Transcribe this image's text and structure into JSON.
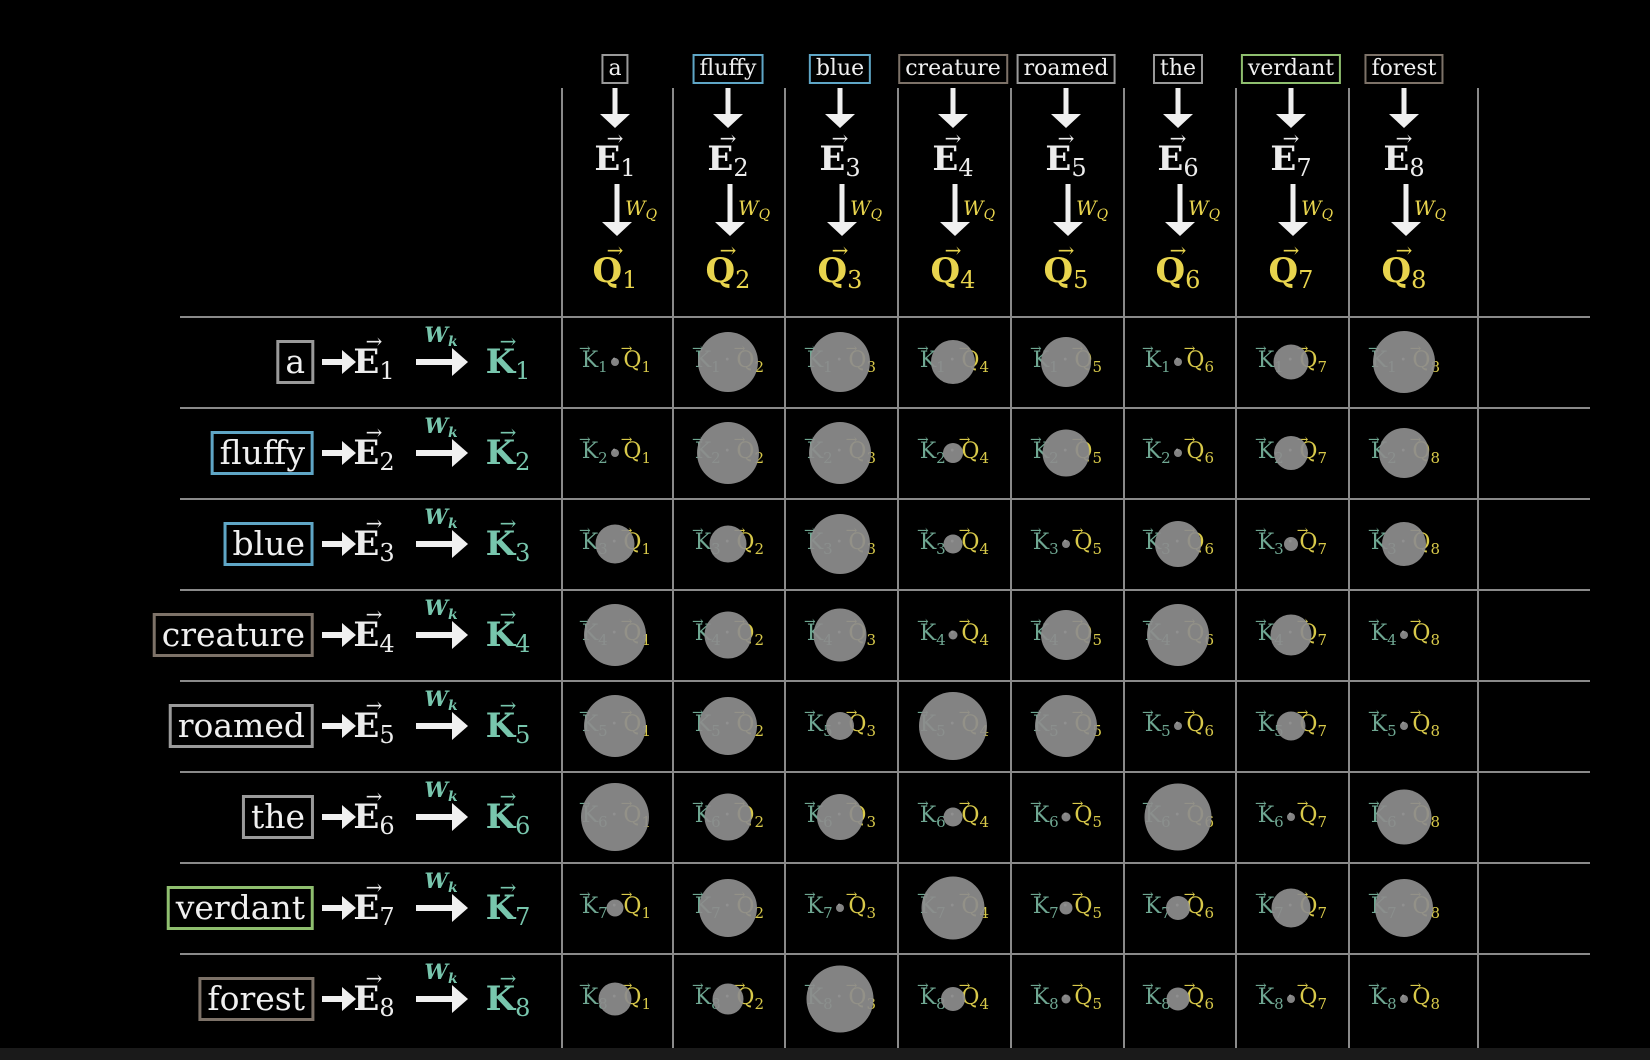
{
  "tokens": [
    "a",
    "fluffy",
    "blue",
    "creature",
    "roamed",
    "the",
    "verdant",
    "forest"
  ],
  "token_colors": [
    "#9a9a9a",
    "#5fa6c6",
    "#5fa6c6",
    "#7d7268",
    "#9a9a9a",
    "#9a9a9a",
    "#8fbf6f",
    "#7d7268"
  ],
  "symbols": {
    "embedding": "E",
    "query": "Q",
    "key": "K",
    "query_matrix": "W",
    "query_matrix_sub": "Q",
    "key_matrix": "W",
    "key_matrix_sub": "k",
    "vector_arrow": "⃗",
    "dot_operator": "·"
  },
  "colors": {
    "query": "#e8d44d",
    "key": "#78c6ad",
    "grid": "#8a8a8a",
    "circle": "#8d8d8d"
  },
  "dot_product_magnitudes": [
    [
      0.12,
      0.88,
      0.88,
      0.64,
      0.74,
      0.06,
      0.51,
      0.91
    ],
    [
      0.05,
      0.91,
      0.91,
      0.3,
      0.69,
      0.05,
      0.5,
      0.74
    ],
    [
      0.57,
      0.55,
      0.88,
      0.28,
      0.09,
      0.67,
      0.2,
      0.65
    ],
    [
      0.91,
      0.69,
      0.78,
      0.13,
      0.74,
      0.91,
      0.6,
      0.06
    ],
    [
      0.91,
      0.86,
      0.41,
      1.0,
      0.91,
      0.06,
      0.43,
      0.06
    ],
    [
      1.0,
      0.69,
      0.67,
      0.28,
      0.13,
      0.99,
      0.06,
      0.81
    ],
    [
      0.25,
      0.86,
      0.09,
      0.93,
      0.19,
      0.35,
      0.58,
      0.86
    ],
    [
      0.48,
      0.46,
      0.99,
      0.36,
      0.13,
      0.34,
      0.06,
      0.06
    ]
  ]
}
